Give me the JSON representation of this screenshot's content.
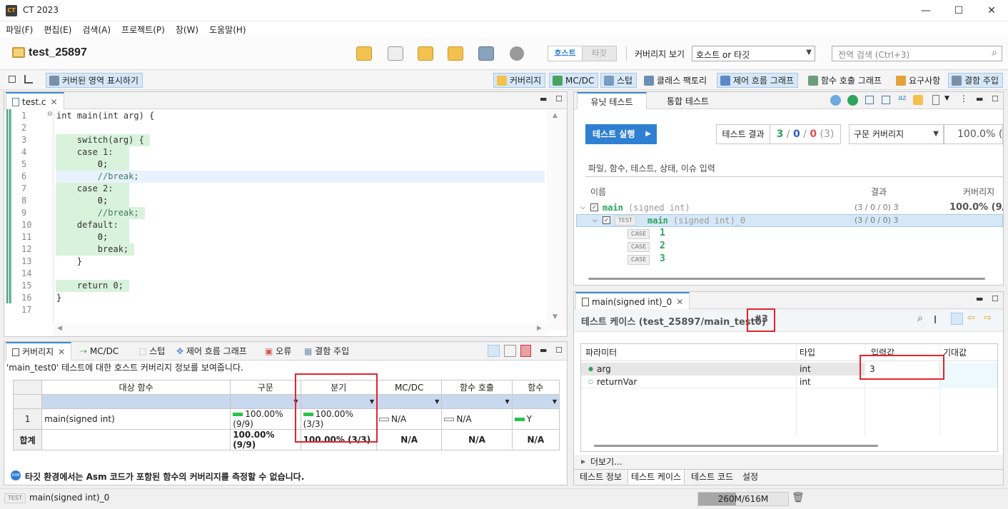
{
  "window": {
    "title": "CT 2023",
    "app_icon": "CT",
    "min": "—",
    "max": "☐",
    "close": "✕"
  },
  "menu": [
    "파일(F)",
    "편집(E)",
    "검색(A)",
    "프로젝트(P)",
    "창(W)",
    "도움말(H)"
  ],
  "project": {
    "name": "test_25897",
    "mode_host": "호스트",
    "mode_target": "타깃",
    "coverage_view_label": "커버리지 보기",
    "coverage_view_value": "호스트 or 타깃",
    "search_placeholder": "전역 검색 (Ctrl+3)"
  },
  "toolbar2": {
    "show_covered": "커버된 영역 표시하기",
    "coverage": "커버리지",
    "mcdc": "MC/DC",
    "stub": "스텁",
    "class_factory": "클래스 팩토리",
    "control_flow": "제어 흐름 그래프",
    "call_graph": "함수 호출 그래프",
    "requirements": "요구사항",
    "fault_injection": "결함 주입"
  },
  "editor": {
    "tab": "test.c",
    "lines": [
      {
        "n": "1",
        "text": "int main(int arg) {"
      },
      {
        "n": "2",
        "text": ""
      },
      {
        "n": "3",
        "text": "    switch(arg) {"
      },
      {
        "n": "4",
        "text": "    case 1:"
      },
      {
        "n": "5",
        "text": "        0;"
      },
      {
        "n": "6",
        "text": "        //break;"
      },
      {
        "n": "7",
        "text": "    case 2:"
      },
      {
        "n": "8",
        "text": "        0;"
      },
      {
        "n": "9",
        "text": "        //break;"
      },
      {
        "n": "10",
        "text": "    default:"
      },
      {
        "n": "11",
        "text": "        0;"
      },
      {
        "n": "12",
        "text": "        break;"
      },
      {
        "n": "13",
        "text": "    }"
      },
      {
        "n": "14",
        "text": ""
      },
      {
        "n": "15",
        "text": "    return 0;"
      },
      {
        "n": "16",
        "text": "}"
      },
      {
        "n": "17",
        "text": ""
      }
    ]
  },
  "coverage_view": {
    "tabs": [
      "커버리지",
      "MC/DC",
      "스텁",
      "제어 흐름 그래프",
      "오류",
      "결함 주입"
    ],
    "info": "'main_test0' 테스트에 대한 호스트 커버리지 정보를 보여줍니다.",
    "headers": [
      "대상 함수",
      "구문",
      "분기",
      "MC/DC",
      "함수 호출",
      "함수"
    ],
    "row": {
      "idx": "1",
      "fn": "main(signed int)",
      "stmt": "100.00% (9/9)",
      "branch": "100.00% (3/3)",
      "mcdc": "N/A",
      "call": "N/A",
      "func": "Y"
    },
    "total": {
      "label": "합계",
      "stmt": "100.00% (9/9)",
      "branch": "100.00% (3/3)",
      "mcdc": "N/A",
      "call": "N/A",
      "func": "N/A"
    },
    "footer_badge": "ASM",
    "footer": "타깃 환경에서는 Asm 코드가 포함된 함수의 커버리지를 측정할 수 없습니다."
  },
  "unit_test": {
    "tabs": [
      "유닛 테스트",
      "통합 테스트"
    ],
    "run_button": "테스트 실행",
    "result_label": "테스트 결과",
    "result_pass": "3",
    "result_fail": "0",
    "result_err": "0",
    "result_total": "(3)",
    "sep": "/",
    "coverage_type": "구문 커버리지",
    "coverage_value": "100.0% (",
    "filter_placeholder": "파일, 함수, 테스트, 상태, 이슈 입력",
    "col_name": "이름",
    "col_result": "결과",
    "col_coverage": "커버리지",
    "tree": {
      "fn_name": "main",
      "fn_sig": "(signed int)",
      "fn_result": "(3 / 0 / 0) 3",
      "fn_cov": "100.0% (9/",
      "test_badge": "TEST",
      "test_name": "main",
      "test_sig": "(signed int)_0",
      "test_result": "(3 / 0 / 0) 3",
      "case_badge": "CASE",
      "cases": [
        "1",
        "2",
        "3"
      ]
    }
  },
  "test_case_view": {
    "tab": "main(signed int)_0",
    "header": "테스트 케이스 (test_25897/main_test0)",
    "case_no": "#3",
    "columns": [
      "파라미터",
      "타입",
      "입력값",
      "기대값"
    ],
    "rows": [
      {
        "param": "arg",
        "type": "int",
        "input": "3",
        "expected": ""
      },
      {
        "param": "returnVar",
        "type": "int",
        "input": "",
        "expected": ""
      }
    ],
    "more": "더보기...",
    "bottom_tabs": [
      "테스트 정보",
      "테스트 케이스",
      "테스트 코드",
      "설정"
    ]
  },
  "status": {
    "badge": "TEST",
    "text": "main(signed int)_0",
    "memory": "260M/616M"
  },
  "colors": {
    "accent": "#2f7fd2",
    "green": "#2cc24a",
    "highlight": "#e3242b"
  }
}
